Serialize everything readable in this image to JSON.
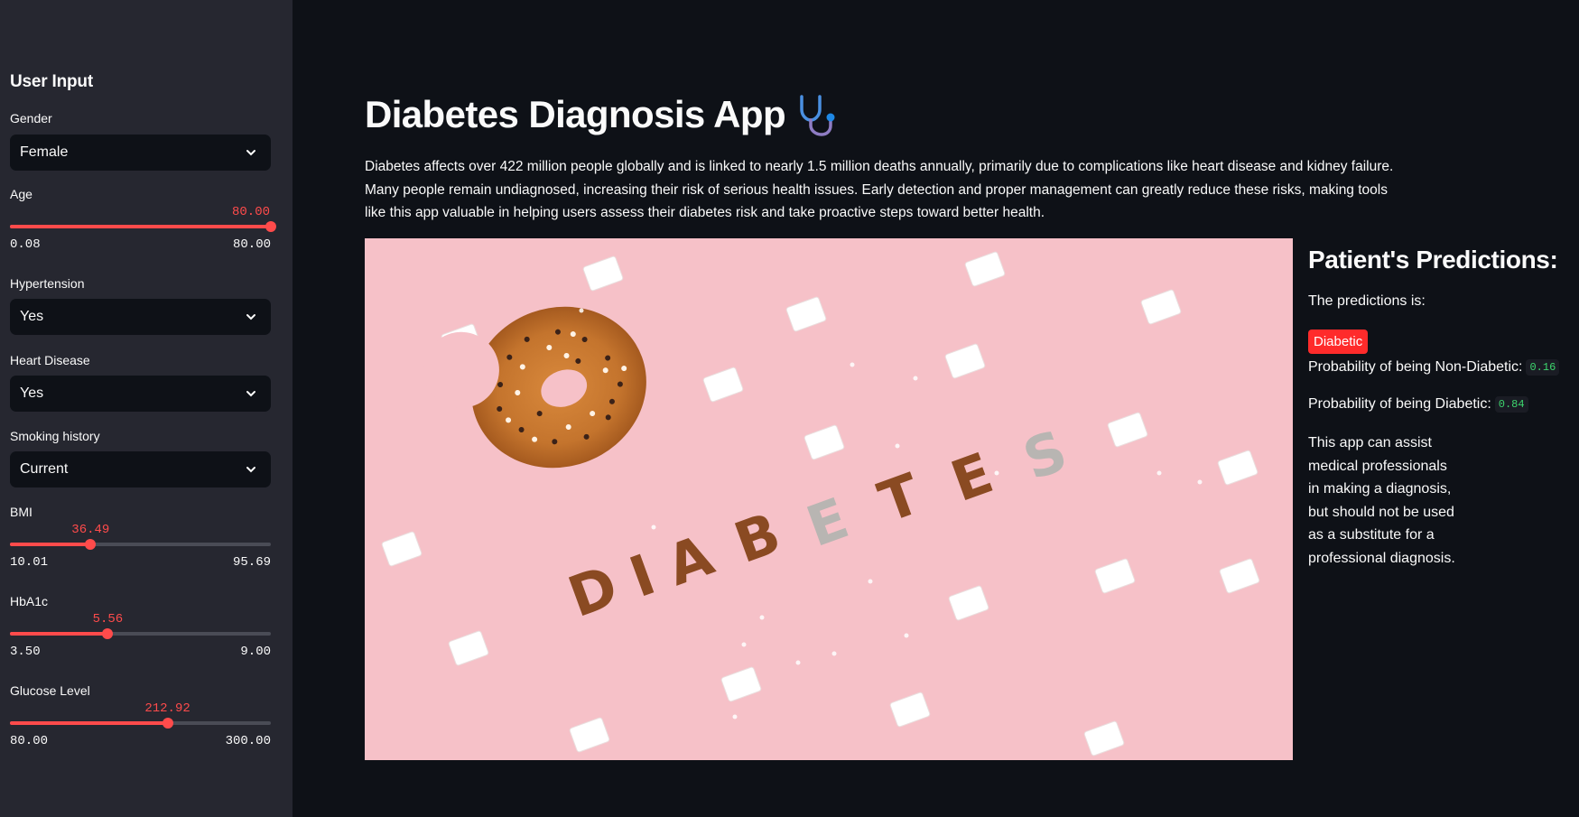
{
  "sidebar": {
    "title": "User Input",
    "gender": {
      "label": "Gender",
      "value": "Female"
    },
    "age": {
      "label": "Age",
      "value": "80.00",
      "min": "0.08",
      "max": "80.00",
      "fraction": 1.0
    },
    "hypertension": {
      "label": "Hypertension",
      "value": "Yes"
    },
    "heart_disease": {
      "label": "Heart Disease",
      "value": "Yes"
    },
    "smoking": {
      "label": "Smoking history",
      "value": "Current"
    },
    "bmi": {
      "label": "BMI",
      "value": "36.49",
      "min": "10.01",
      "max": "95.69",
      "fraction": 0.309
    },
    "hba1c": {
      "label": "HbA1c",
      "value": "5.56",
      "min": "3.50",
      "max": "9.00",
      "fraction": 0.375
    },
    "glucose": {
      "label": "Glucose Level",
      "value": "212.92",
      "min": "80.00",
      "max": "300.00",
      "fraction": 0.604
    }
  },
  "main": {
    "title": "Diabetes Diagnosis App",
    "title_icon": "stethoscope-icon",
    "description": "Diabetes affects over 422 million people globally and is linked to nearly 1.5 million deaths annually, primarily due to complications like heart disease and kidney failure. Many people remain undiagnosed, increasing their risk of serious health issues. Early detection and proper management can greatly reduce these risks, making tools like this app valuable in helping users assess their diabetes risk and take proactive steps toward better health.",
    "hero_text": [
      "D",
      "I",
      "A",
      "B",
      "E",
      "T",
      "E",
      "S"
    ]
  },
  "predictions": {
    "title": "Patient's Predictions:",
    "intro": "The predictions is:",
    "result": "Diabetic",
    "non_diabetic_label": "Probability of being Non-Diabetic:",
    "non_diabetic_value": "0.16",
    "diabetic_label": "Probability of being Diabetic:",
    "diabetic_value": "0.84",
    "note": "This app can assist medical professionals in making a diagnosis, but should not be used as a substitute for a professional diagnosis."
  },
  "colors": {
    "accent": "#ff4b4b",
    "background": "#0e1117",
    "sidebar": "#262730",
    "badge": "#ff2b2b",
    "code_green": "#3dd56d"
  }
}
